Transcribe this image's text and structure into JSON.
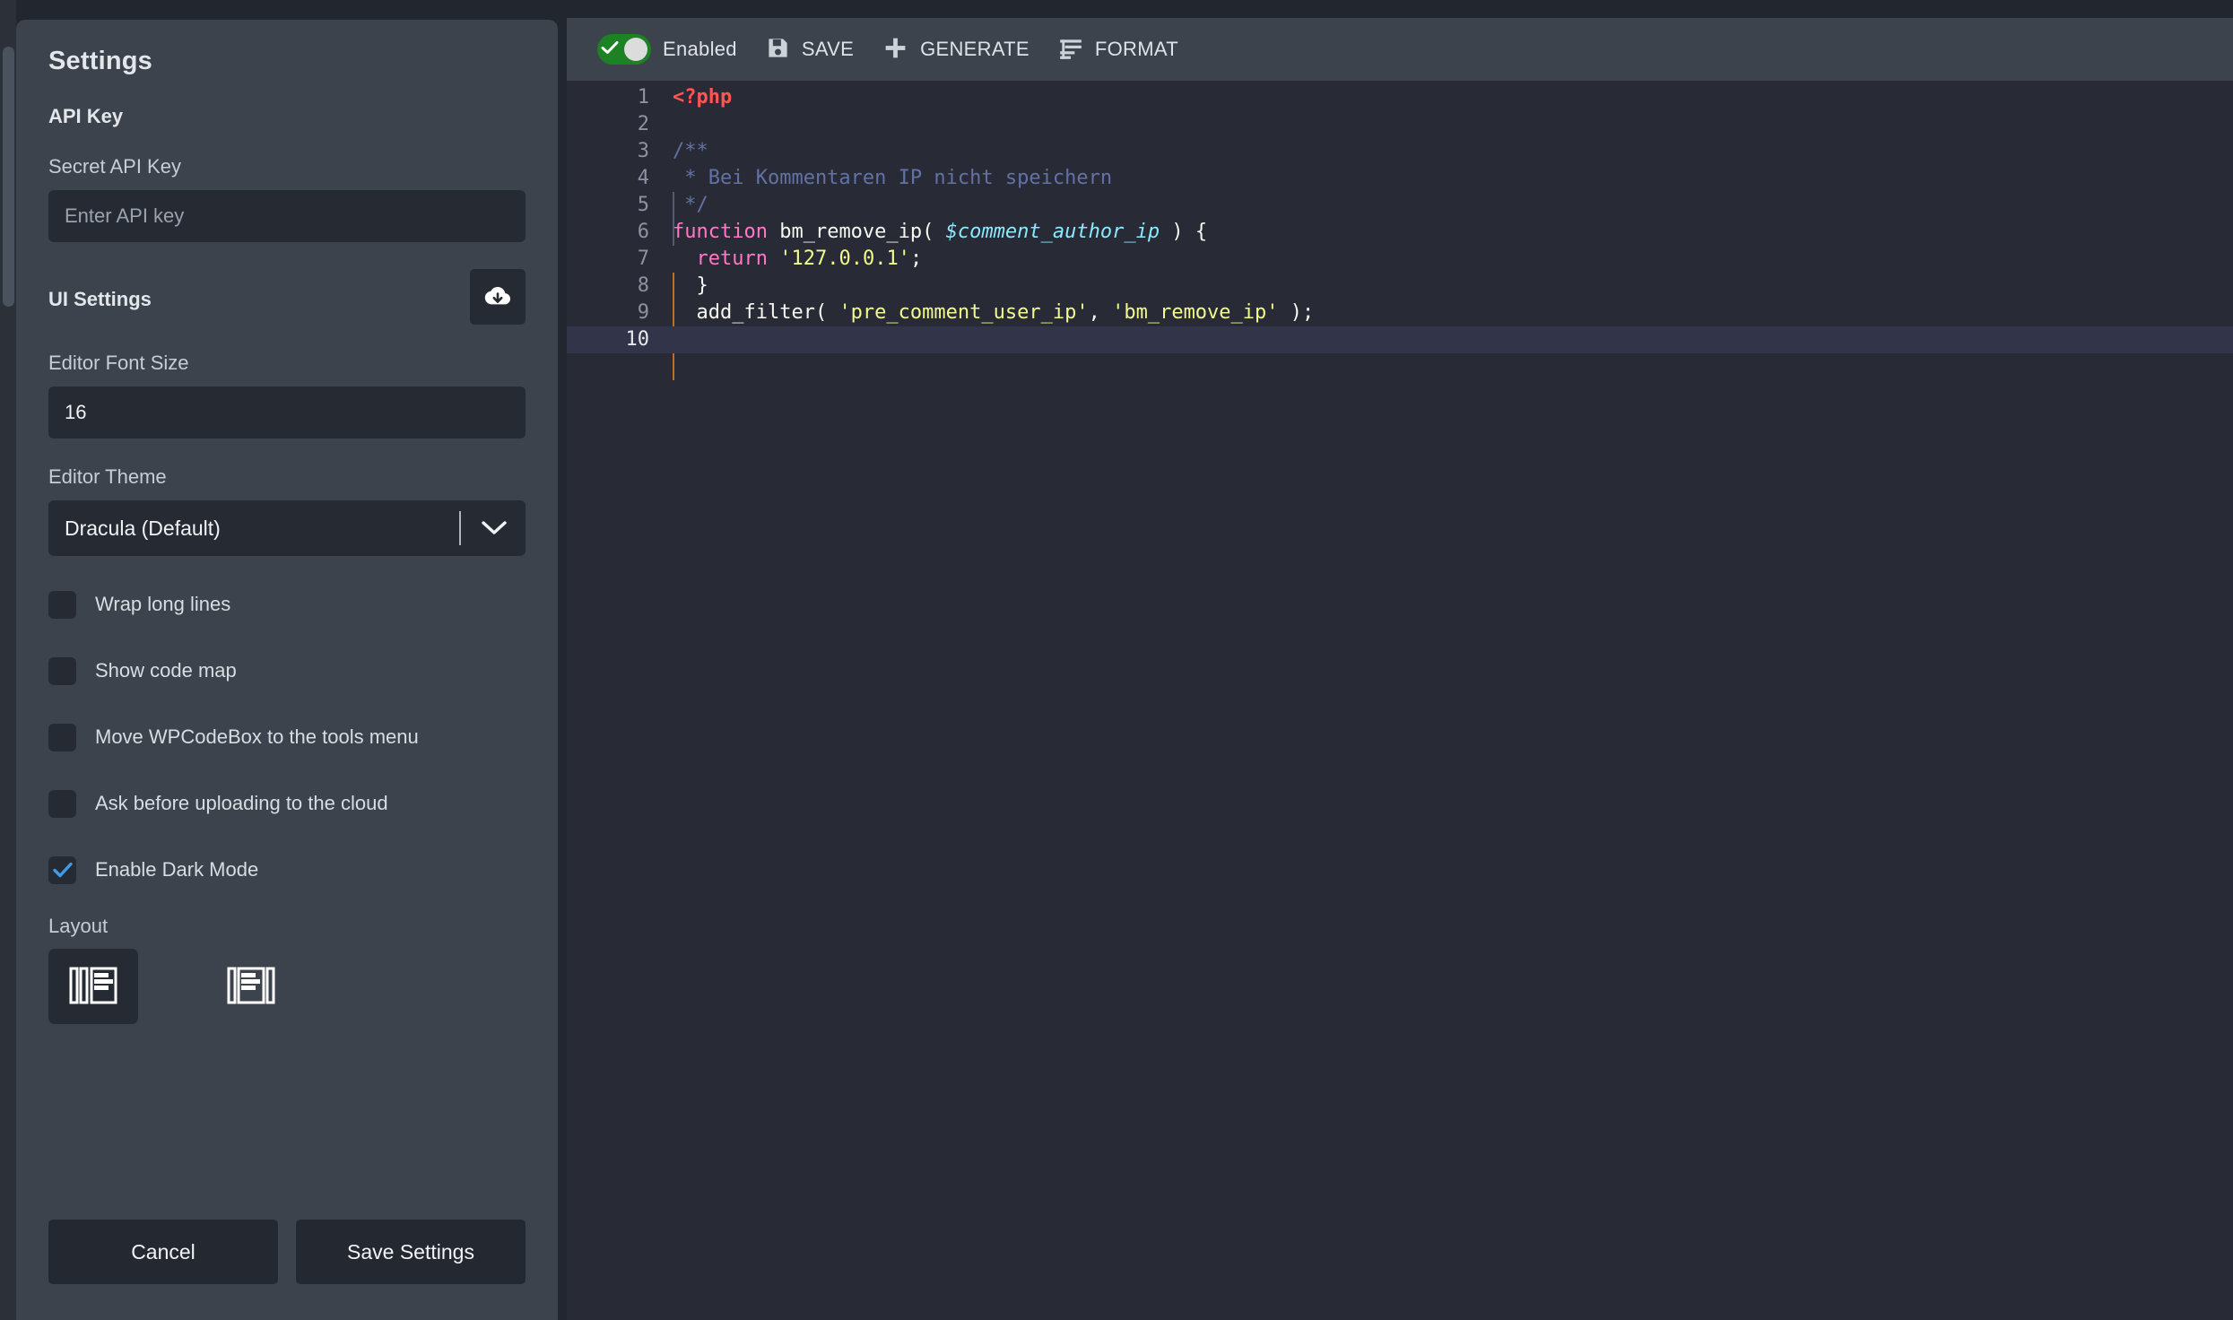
{
  "sidebar": {
    "title": "Settings",
    "api_section": {
      "heading": "API Key",
      "secret_label": "Secret API Key",
      "secret_placeholder": "Enter API key",
      "secret_value": ""
    },
    "ui_section": {
      "heading": "UI Settings",
      "cloud_icon": "cloud-download-icon",
      "font_size_label": "Editor Font Size",
      "font_size_value": "16",
      "theme_label": "Editor Theme",
      "theme_value": "Dracula (Default)",
      "theme_arrow_icon": "chevron-down-icon"
    },
    "checkboxes": [
      {
        "label": "Wrap long lines",
        "checked": false
      },
      {
        "label": "Show code map",
        "checked": false
      },
      {
        "label": "Move WPCodeBox to the tools menu",
        "checked": false
      },
      {
        "label": "Ask before uploading to the cloud",
        "checked": false
      },
      {
        "label": "Enable Dark Mode",
        "checked": true
      }
    ],
    "layout": {
      "label": "Layout",
      "options": [
        {
          "name": "layout-sidebar-left",
          "selected": true
        },
        {
          "name": "layout-sidebar-split",
          "selected": false
        }
      ]
    },
    "buttons": {
      "cancel": "Cancel",
      "save": "Save Settings"
    }
  },
  "toolbar": {
    "enabled_label": "Enabled",
    "enabled": true,
    "save_label": "SAVE",
    "save_icon": "floppy-disk-icon",
    "generate_label": "GENERATE",
    "generate_icon": "plus-icon",
    "format_label": "FORMAT",
    "format_icon": "format-lines-icon"
  },
  "editor": {
    "theme_name": "Dracula",
    "active_line": 10,
    "lines": [
      {
        "n": "1",
        "tokens": [
          {
            "t": "<?php",
            "c": "t-tag"
          }
        ]
      },
      {
        "n": "2",
        "tokens": []
      },
      {
        "n": "3",
        "tokens": [
          {
            "t": "/**",
            "c": "t-comment"
          }
        ]
      },
      {
        "n": "4",
        "tokens": [
          {
            "t": " * Bei Kommentaren IP nicht speichern",
            "c": "t-comment"
          }
        ]
      },
      {
        "n": "5",
        "tokens": [
          {
            "t": " */",
            "c": "t-comment"
          }
        ]
      },
      {
        "n": "6",
        "tokens": [
          {
            "t": "function",
            "c": "t-keyword"
          },
          {
            "t": " bm_remove_ip( ",
            "c": "t-func"
          },
          {
            "t": "$comment_author_ip",
            "c": "t-var"
          },
          {
            "t": " ) {",
            "c": "t-plain"
          }
        ]
      },
      {
        "n": "7",
        "tokens": [
          {
            "t": "  ",
            "c": "t-plain"
          },
          {
            "t": "return",
            "c": "t-keyword"
          },
          {
            "t": " ",
            "c": "t-plain"
          },
          {
            "t": "'127.0.0.1'",
            "c": "t-string"
          },
          {
            "t": ";",
            "c": "t-plain"
          }
        ]
      },
      {
        "n": "8",
        "tokens": [
          {
            "t": "  }",
            "c": "t-plain"
          }
        ]
      },
      {
        "n": "9",
        "tokens": [
          {
            "t": "  add_filter( ",
            "c": "t-plain"
          },
          {
            "t": "'pre_comment_user_ip'",
            "c": "t-string"
          },
          {
            "t": ", ",
            "c": "t-plain"
          },
          {
            "t": "'bm_remove_ip'",
            "c": "t-string"
          },
          {
            "t": " );",
            "c": "t-plain"
          }
        ]
      },
      {
        "n": "10",
        "tokens": []
      }
    ]
  },
  "colors": {
    "sidebar_bg": "#3c434d",
    "input_bg": "#262b33",
    "editor_bg": "#282a36",
    "toolbar_bg": "#3c434d",
    "toggle_on": "#1d8224",
    "checkbox_accent": "#3d9be9",
    "active_line": "#32344a",
    "indent_guide_orange": "#b5731f"
  }
}
